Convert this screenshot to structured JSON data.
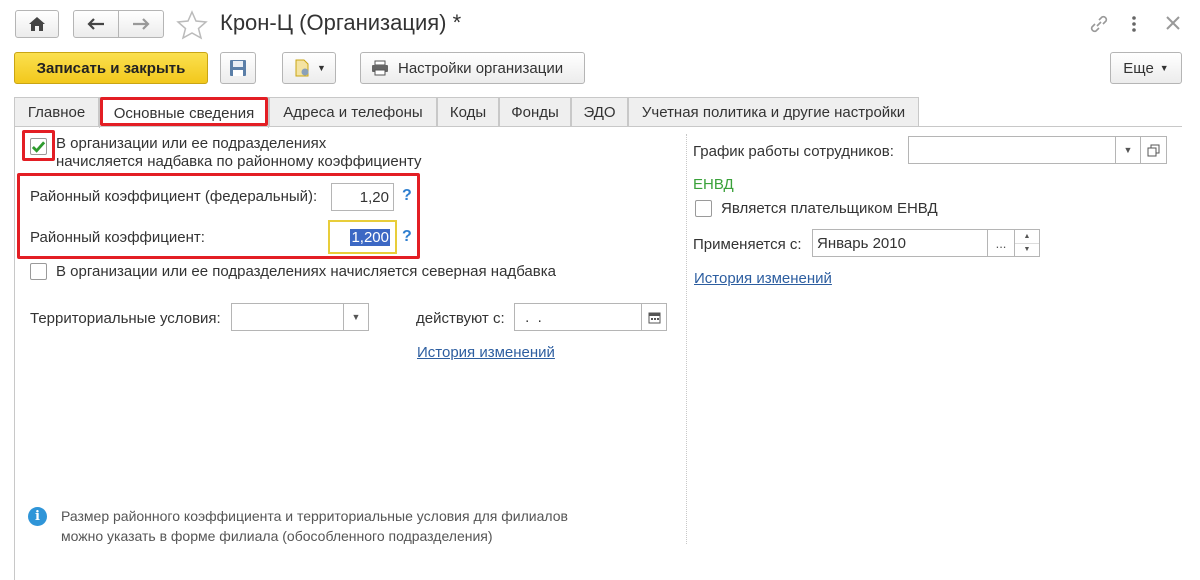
{
  "window": {
    "title": "Крон-Ц (Организация) *"
  },
  "toolbar": {
    "save_close": "Записать и закрыть",
    "org_settings": "Настройки организации",
    "more": "Еще"
  },
  "tabs": [
    {
      "label": "Главное"
    },
    {
      "label": "Основные сведения"
    },
    {
      "label": "Адреса и телефоны"
    },
    {
      "label": "Коды"
    },
    {
      "label": "Фонды"
    },
    {
      "label": "ЭДО"
    },
    {
      "label": "Учетная политика и другие настройки"
    }
  ],
  "left": {
    "regional_checkbox_line1": "В организации или ее подразделениях",
    "regional_checkbox_line2": "начисляется надбавка по районному коэффициенту",
    "regional_checked": true,
    "federal_coef_label": "Районный коэффициент (федеральный):",
    "federal_coef_value": "1,20",
    "coef_label": "Районный коэффициент:",
    "coef_value": "1,200",
    "help": "?",
    "north_label": "В организации или ее подразделениях начисляется северная надбавка",
    "north_checked": false,
    "terr_label": "Территориальные условия:",
    "terr_value": "",
    "valid_from_label": "действуют с:",
    "valid_from_value": " .  .",
    "history_link": "История изменений",
    "hint_line1": "Размер районного коэффициента и территориальные условия для филиалов",
    "hint_line2": "можно указать в форме филиала (обособленного подразделения)"
  },
  "right": {
    "schedule_label": "График работы сотрудников:",
    "schedule_value": "",
    "envd_header": "ЕНВД",
    "envd_checkbox_label": "Является плательщиком ЕНВД",
    "envd_checked": false,
    "applied_from_label": "Применяется с:",
    "applied_from_value": "Январь 2010",
    "dots": "...",
    "history_link": "История изменений"
  },
  "colors": {
    "save_button": "#f7d22f",
    "highlight_red": "#e31e24",
    "envd_green": "#3aa13a",
    "link_blue": "#2d5ea0",
    "selected_text_bg": "#3c68c4"
  }
}
